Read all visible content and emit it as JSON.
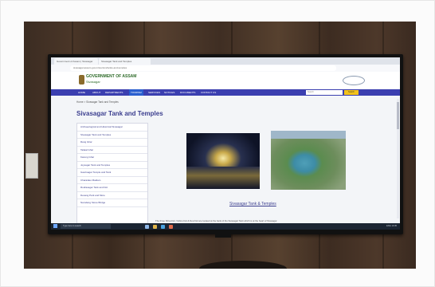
{
  "browser": {
    "tabs": [
      "Government of Assam | Sivasagar",
      "Sivasagar Tank and Temples"
    ],
    "url": "sivasagar.assam.gov.in/tourism/tanks-and-temples"
  },
  "site": {
    "government": "GOVERNMENT OF ASSAM",
    "district": "Sivasagar"
  },
  "nav": {
    "items": [
      "HOME",
      "ABOUT",
      "DEPARTMENTS",
      "TOURISM",
      "SERVICES",
      "NOTICES",
      "DOCUMENTS",
      "CONTACT US"
    ],
    "active": "TOURISM",
    "search_placeholder": "Search",
    "search_button": "Search"
  },
  "page": {
    "breadcrumb": "Home > Sivasagar Tank and Temples",
    "title": "Sivasagar Tank and Temples",
    "caption": "Sivasagar Tank & Temples",
    "paragraph": "The three Shiva Dol, Vishnu Dol & Devi Dol are located at the bank of the Sivasagar Tank which is at the heart of Sivasagar"
  },
  "sidebar": {
    "items": [
      "Archaeological and Historical Sivasagar",
      "Sivasagar Tank and Temples",
      "Rang Ghar",
      "Talatal Ghar",
      "Kareng Ghar",
      "Joysagar Tank and Temples",
      "Gaurisagar Temple and Tank",
      "Charaideo Maidam",
      "Rudrasagar Tank and Dol",
      "Desang Park and More",
      "Namdang Stone Bridge"
    ]
  },
  "taskbar": {
    "search_placeholder": "Type here to search",
    "tray_text": "ENG 10:45"
  }
}
